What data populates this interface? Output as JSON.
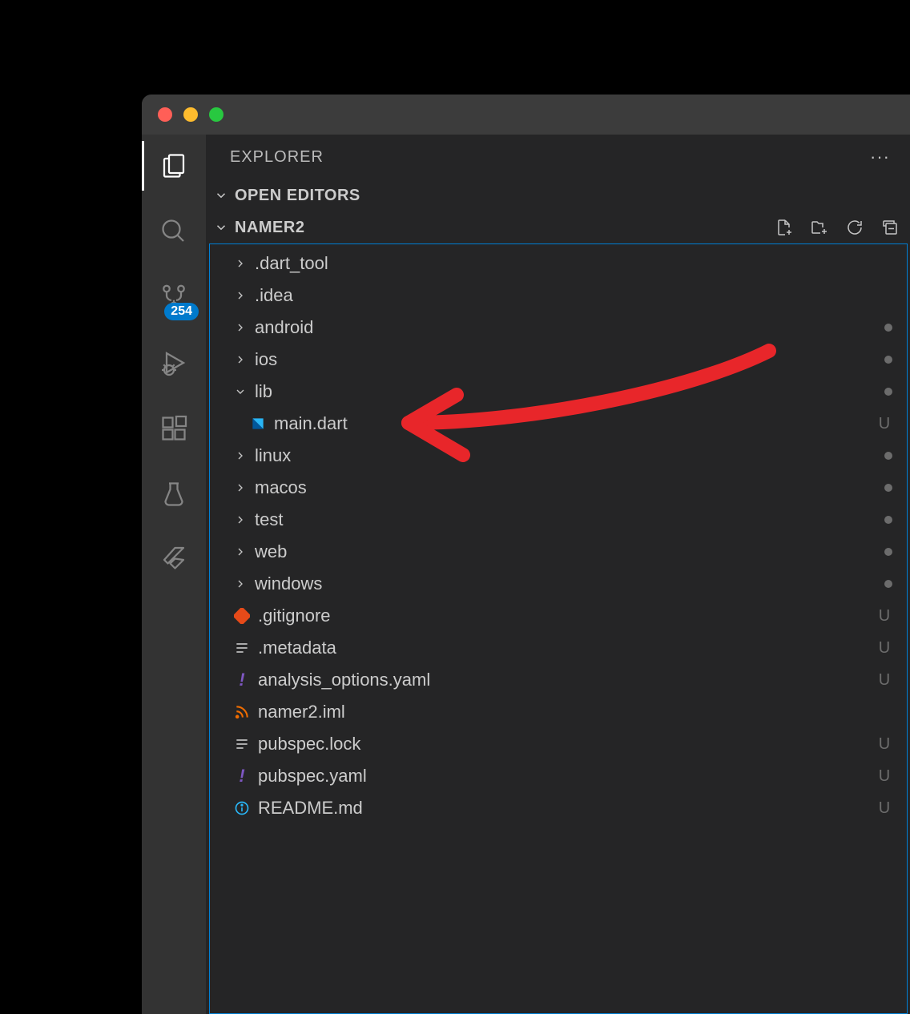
{
  "titlebar": {},
  "activity_bar": {
    "badge_count": "254"
  },
  "sidebar": {
    "title": "EXPLORER",
    "sections": {
      "open_editors": {
        "label": "OPEN EDITORS"
      },
      "folder": {
        "label": "NAMER2"
      }
    },
    "tree": [
      {
        "type": "folder",
        "name": ".dart_tool",
        "chevron": "right",
        "depth": 1,
        "status": ""
      },
      {
        "type": "folder",
        "name": ".idea",
        "chevron": "right",
        "depth": 1,
        "status": ""
      },
      {
        "type": "folder",
        "name": "android",
        "chevron": "right",
        "depth": 1,
        "status": "dot"
      },
      {
        "type": "folder",
        "name": "ios",
        "chevron": "right",
        "depth": 1,
        "status": "dot"
      },
      {
        "type": "folder",
        "name": "lib",
        "chevron": "down",
        "depth": 1,
        "status": "dot"
      },
      {
        "type": "file",
        "name": "main.dart",
        "icon": "dart",
        "depth": 2,
        "status": "U"
      },
      {
        "type": "folder",
        "name": "linux",
        "chevron": "right",
        "depth": 1,
        "status": "dot"
      },
      {
        "type": "folder",
        "name": "macos",
        "chevron": "right",
        "depth": 1,
        "status": "dot"
      },
      {
        "type": "folder",
        "name": "test",
        "chevron": "right",
        "depth": 1,
        "status": "dot"
      },
      {
        "type": "folder",
        "name": "web",
        "chevron": "right",
        "depth": 1,
        "status": "dot"
      },
      {
        "type": "folder",
        "name": "windows",
        "chevron": "right",
        "depth": 1,
        "status": "dot"
      },
      {
        "type": "file",
        "name": ".gitignore",
        "icon": "git",
        "depth": 1,
        "status": "U"
      },
      {
        "type": "file",
        "name": ".metadata",
        "icon": "lines",
        "depth": 1,
        "status": "U"
      },
      {
        "type": "file",
        "name": "analysis_options.yaml",
        "icon": "yaml",
        "depth": 1,
        "status": "U"
      },
      {
        "type": "file",
        "name": "namer2.iml",
        "icon": "feed",
        "depth": 1,
        "status": ""
      },
      {
        "type": "file",
        "name": "pubspec.lock",
        "icon": "lines",
        "depth": 1,
        "status": "U"
      },
      {
        "type": "file",
        "name": "pubspec.yaml",
        "icon": "yaml",
        "depth": 1,
        "status": "U"
      },
      {
        "type": "file",
        "name": "README.md",
        "icon": "info",
        "depth": 1,
        "status": "U"
      }
    ]
  }
}
